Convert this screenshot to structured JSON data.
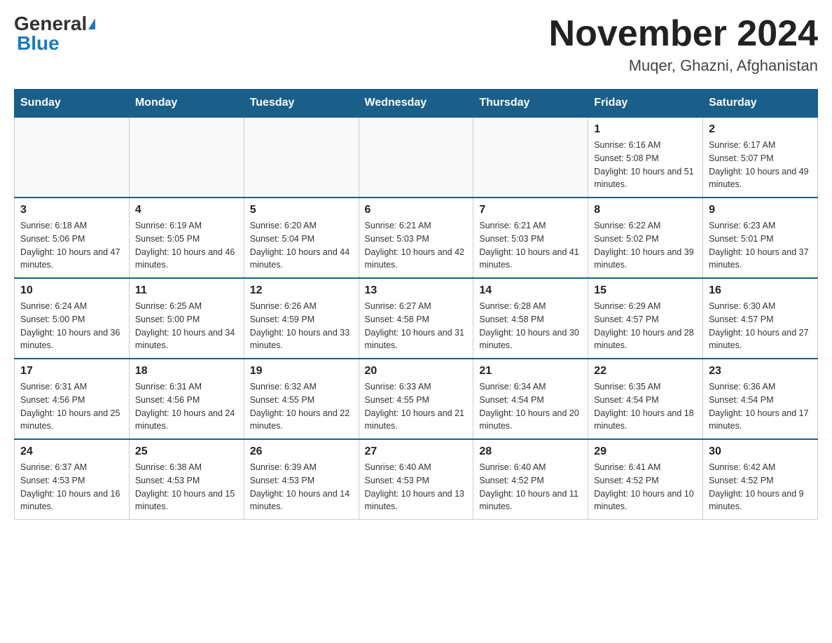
{
  "header": {
    "logo_general": "General",
    "logo_blue": "Blue",
    "month_title": "November 2024",
    "location": "Muqer, Ghazni, Afghanistan"
  },
  "days_of_week": [
    "Sunday",
    "Monday",
    "Tuesday",
    "Wednesday",
    "Thursday",
    "Friday",
    "Saturday"
  ],
  "weeks": [
    [
      {
        "day": "",
        "info": ""
      },
      {
        "day": "",
        "info": ""
      },
      {
        "day": "",
        "info": ""
      },
      {
        "day": "",
        "info": ""
      },
      {
        "day": "",
        "info": ""
      },
      {
        "day": "1",
        "info": "Sunrise: 6:16 AM\nSunset: 5:08 PM\nDaylight: 10 hours and 51 minutes."
      },
      {
        "day": "2",
        "info": "Sunrise: 6:17 AM\nSunset: 5:07 PM\nDaylight: 10 hours and 49 minutes."
      }
    ],
    [
      {
        "day": "3",
        "info": "Sunrise: 6:18 AM\nSunset: 5:06 PM\nDaylight: 10 hours and 47 minutes."
      },
      {
        "day": "4",
        "info": "Sunrise: 6:19 AM\nSunset: 5:05 PM\nDaylight: 10 hours and 46 minutes."
      },
      {
        "day": "5",
        "info": "Sunrise: 6:20 AM\nSunset: 5:04 PM\nDaylight: 10 hours and 44 minutes."
      },
      {
        "day": "6",
        "info": "Sunrise: 6:21 AM\nSunset: 5:03 PM\nDaylight: 10 hours and 42 minutes."
      },
      {
        "day": "7",
        "info": "Sunrise: 6:21 AM\nSunset: 5:03 PM\nDaylight: 10 hours and 41 minutes."
      },
      {
        "day": "8",
        "info": "Sunrise: 6:22 AM\nSunset: 5:02 PM\nDaylight: 10 hours and 39 minutes."
      },
      {
        "day": "9",
        "info": "Sunrise: 6:23 AM\nSunset: 5:01 PM\nDaylight: 10 hours and 37 minutes."
      }
    ],
    [
      {
        "day": "10",
        "info": "Sunrise: 6:24 AM\nSunset: 5:00 PM\nDaylight: 10 hours and 36 minutes."
      },
      {
        "day": "11",
        "info": "Sunrise: 6:25 AM\nSunset: 5:00 PM\nDaylight: 10 hours and 34 minutes."
      },
      {
        "day": "12",
        "info": "Sunrise: 6:26 AM\nSunset: 4:59 PM\nDaylight: 10 hours and 33 minutes."
      },
      {
        "day": "13",
        "info": "Sunrise: 6:27 AM\nSunset: 4:58 PM\nDaylight: 10 hours and 31 minutes."
      },
      {
        "day": "14",
        "info": "Sunrise: 6:28 AM\nSunset: 4:58 PM\nDaylight: 10 hours and 30 minutes."
      },
      {
        "day": "15",
        "info": "Sunrise: 6:29 AM\nSunset: 4:57 PM\nDaylight: 10 hours and 28 minutes."
      },
      {
        "day": "16",
        "info": "Sunrise: 6:30 AM\nSunset: 4:57 PM\nDaylight: 10 hours and 27 minutes."
      }
    ],
    [
      {
        "day": "17",
        "info": "Sunrise: 6:31 AM\nSunset: 4:56 PM\nDaylight: 10 hours and 25 minutes."
      },
      {
        "day": "18",
        "info": "Sunrise: 6:31 AM\nSunset: 4:56 PM\nDaylight: 10 hours and 24 minutes."
      },
      {
        "day": "19",
        "info": "Sunrise: 6:32 AM\nSunset: 4:55 PM\nDaylight: 10 hours and 22 minutes."
      },
      {
        "day": "20",
        "info": "Sunrise: 6:33 AM\nSunset: 4:55 PM\nDaylight: 10 hours and 21 minutes."
      },
      {
        "day": "21",
        "info": "Sunrise: 6:34 AM\nSunset: 4:54 PM\nDaylight: 10 hours and 20 minutes."
      },
      {
        "day": "22",
        "info": "Sunrise: 6:35 AM\nSunset: 4:54 PM\nDaylight: 10 hours and 18 minutes."
      },
      {
        "day": "23",
        "info": "Sunrise: 6:36 AM\nSunset: 4:54 PM\nDaylight: 10 hours and 17 minutes."
      }
    ],
    [
      {
        "day": "24",
        "info": "Sunrise: 6:37 AM\nSunset: 4:53 PM\nDaylight: 10 hours and 16 minutes."
      },
      {
        "day": "25",
        "info": "Sunrise: 6:38 AM\nSunset: 4:53 PM\nDaylight: 10 hours and 15 minutes."
      },
      {
        "day": "26",
        "info": "Sunrise: 6:39 AM\nSunset: 4:53 PM\nDaylight: 10 hours and 14 minutes."
      },
      {
        "day": "27",
        "info": "Sunrise: 6:40 AM\nSunset: 4:53 PM\nDaylight: 10 hours and 13 minutes."
      },
      {
        "day": "28",
        "info": "Sunrise: 6:40 AM\nSunset: 4:52 PM\nDaylight: 10 hours and 11 minutes."
      },
      {
        "day": "29",
        "info": "Sunrise: 6:41 AM\nSunset: 4:52 PM\nDaylight: 10 hours and 10 minutes."
      },
      {
        "day": "30",
        "info": "Sunrise: 6:42 AM\nSunset: 4:52 PM\nDaylight: 10 hours and 9 minutes."
      }
    ]
  ]
}
